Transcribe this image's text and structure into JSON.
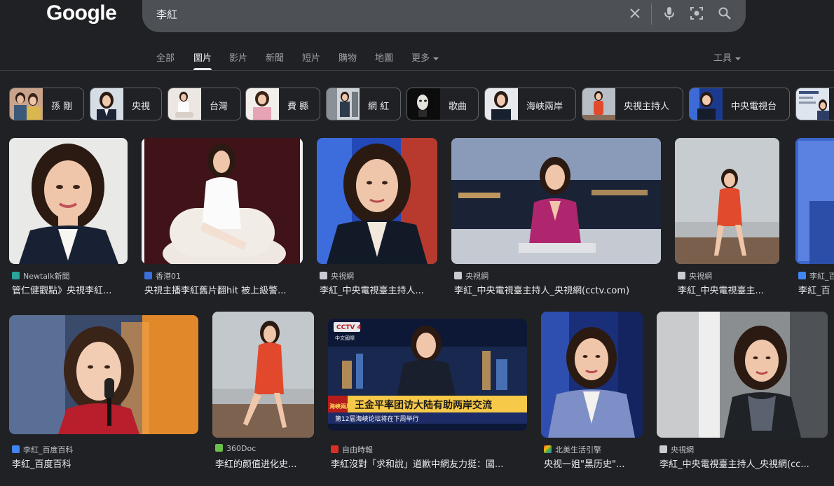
{
  "header": {
    "logo": "Google",
    "query": "李紅"
  },
  "tabs": [
    "全部",
    "圖片",
    "影片",
    "新聞",
    "短片",
    "購物",
    "地圖",
    "更多"
  ],
  "tools_label": "工具",
  "chips": [
    "孫 剛",
    "央視",
    "台灣",
    "費 縣",
    "網 紅",
    "歌曲",
    "海峽兩岸",
    "央視主持人",
    "中央電視台"
  ],
  "results": [
    {
      "source": "Newtalk新聞",
      "title": "管仁健觀點》央視李紅..."
    },
    {
      "source": "香港01",
      "title": "央視主播李紅舊片翻hit 被上級警..."
    },
    {
      "source": "央視網",
      "title": "李紅_中央電視臺主持人..."
    },
    {
      "source": "央視網",
      "title": "李紅_中央電視臺主持人_央視網(cctv.com)"
    },
    {
      "source": "央視網",
      "title": "李紅_中央電視臺主..."
    },
    {
      "source": "李紅_百",
      "title": "李紅_百"
    },
    {
      "source": "李紅_百度百科",
      "title": "李紅_百度百科"
    },
    {
      "source": "360Doc",
      "title": "李红的颜值进化史..."
    },
    {
      "source": "自由時報",
      "title": "李紅沒對「求和說」道歉中網友力挺：國..."
    },
    {
      "source": "北美生活引擎",
      "title": "央视一姐\"黑历史\"..."
    },
    {
      "source": "央視網",
      "title": "李紅_中央電視臺主持人_央視網(cc..."
    }
  ],
  "overlay": {
    "channel": "CCTV 4",
    "channel_sub": "中文國際",
    "headline": "王金平率团访大陆有助两岸交流",
    "subline": "第12屆海峽论坛将在下周举行",
    "side_tag": "海峽兩岸"
  },
  "colors": {
    "background": "#202124",
    "searchbox": "#4d5156",
    "text": "#e8eaed",
    "muted": "#9aa0a6"
  },
  "icons": [
    "clear-icon",
    "mic-icon",
    "lens-icon",
    "search-icon",
    "caret-down-icon"
  ]
}
